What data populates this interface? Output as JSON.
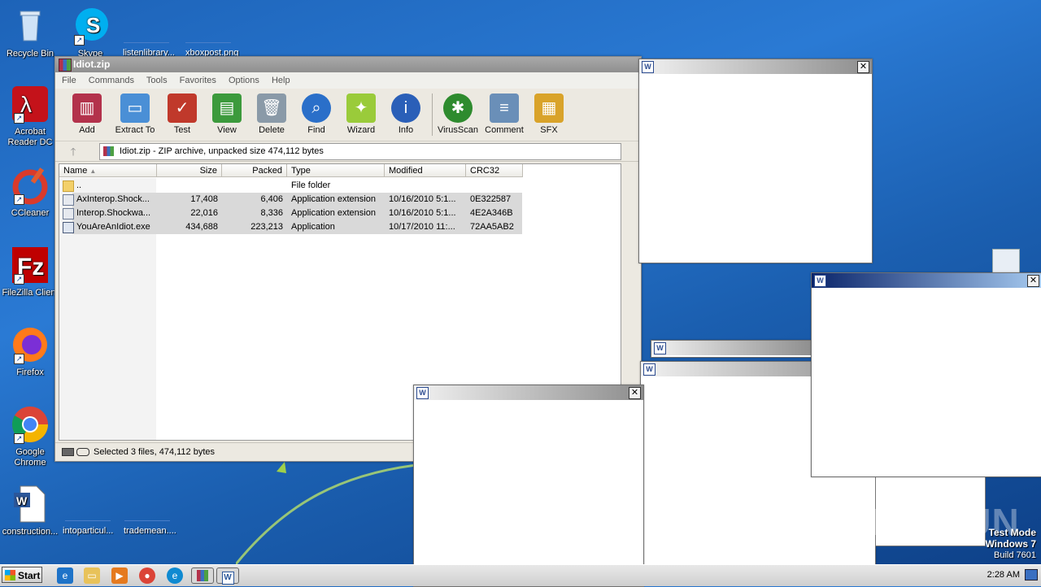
{
  "desktop": {
    "icons": [
      {
        "label": "Recycle Bin"
      },
      {
        "label": "Skype"
      },
      {
        "label": "listenlibrary..."
      },
      {
        "label": "xboxpost.png"
      },
      {
        "label": "Acrobat Reader DC"
      },
      {
        "label": "CCleaner"
      },
      {
        "label": "FileZilla Client"
      },
      {
        "label": "Firefox"
      },
      {
        "label": "Google Chrome"
      },
      {
        "label": "construction..."
      },
      {
        "label": "intoparticul..."
      },
      {
        "label": "trademean...."
      }
    ],
    "watermark": "ANY RUN",
    "test_mode": {
      "line1": "Test Mode",
      "line2": "Windows 7",
      "line3": "Build 7601"
    }
  },
  "winrar": {
    "title": "Idiot.zip",
    "menu": [
      "File",
      "Commands",
      "Tools",
      "Favorites",
      "Options",
      "Help"
    ],
    "toolbar": [
      {
        "label": "Add",
        "icon": "books-icon",
        "color": "#b3324b"
      },
      {
        "label": "Extract To",
        "icon": "folder-icon",
        "color": "#4a8fd6"
      },
      {
        "label": "Test",
        "icon": "clipboard-check-icon",
        "color": "#c0392b"
      },
      {
        "label": "View",
        "icon": "book-icon",
        "color": "#3c9a3c"
      },
      {
        "label": "Delete",
        "icon": "trash-icon",
        "color": "#8a9aa8"
      },
      {
        "label": "Find",
        "icon": "magnifier-icon",
        "color": "#2a6fc9"
      },
      {
        "label": "Wizard",
        "icon": "wand-icon",
        "color": "#9acb3a"
      },
      {
        "label": "Info",
        "icon": "info-icon",
        "color": "#2a5fb8"
      },
      {
        "label": "VirusScan",
        "icon": "bug-icon",
        "color": "#2e8b2e"
      },
      {
        "label": "Comment",
        "icon": "comment-icon",
        "color": "#6a8fb8"
      },
      {
        "label": "SFX",
        "icon": "sfx-box-icon",
        "color": "#d9a32a"
      }
    ],
    "address": "Idiot.zip - ZIP archive, unpacked size 474,112 bytes",
    "columns": [
      "Name",
      "Size",
      "Packed",
      "Type",
      "Modified",
      "CRC32"
    ],
    "rows": [
      {
        "name": "..",
        "size": "",
        "packed": "",
        "type": "File folder",
        "modified": "",
        "crc": ""
      },
      {
        "name": "AxInterop.Shock...",
        "size": "17,408",
        "packed": "6,406",
        "type": "Application extension",
        "modified": "10/16/2010 5:1...",
        "crc": "0E322587"
      },
      {
        "name": "Interop.Shockwa...",
        "size": "22,016",
        "packed": "8,336",
        "type": "Application extension",
        "modified": "10/16/2010 5:1...",
        "crc": "4E2A346B"
      },
      {
        "name": "YouAreAnIdiot.exe",
        "size": "434,688",
        "packed": "223,213",
        "type": "Application",
        "modified": "10/17/2010 11:...",
        "crc": "72AA5AB2"
      }
    ],
    "status": "Selected 3 files, 474,112 bytes"
  },
  "popups": {
    "close_glyph": "✕",
    "icon_glyph": "W"
  },
  "taskbar": {
    "start_label": "Start",
    "clock": "2:28 AM"
  }
}
